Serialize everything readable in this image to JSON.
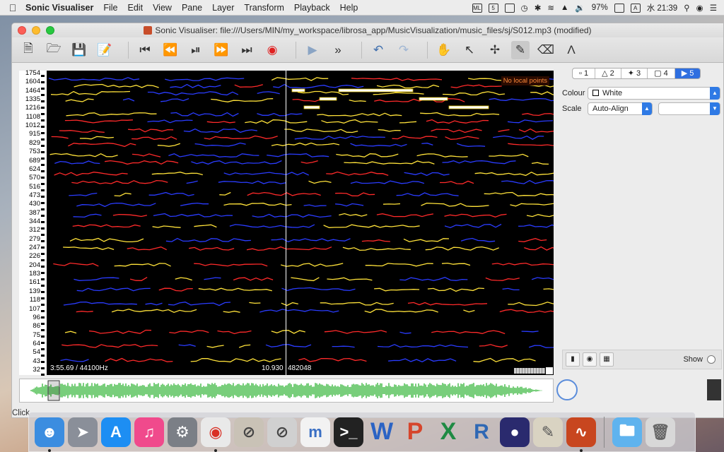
{
  "menubar": {
    "app_name": "Sonic Visualiser",
    "items": [
      "File",
      "Edit",
      "View",
      "Pane",
      "Layer",
      "Transform",
      "Playback",
      "Help"
    ],
    "battery": "97%",
    "input_source": "A",
    "clock": "水 21:39"
  },
  "window": {
    "title": "Sonic Visualiser: file:///Users/MIN/my_workspace/librosa_app/MusicVisualization/music_files/sj/S012.mp3 (modified)"
  },
  "toolbar": {
    "buttons": [
      "new-document-icon",
      "open-icon",
      "save-icon",
      "save-as-icon",
      "rewind-start-icon",
      "rewind-icon",
      "play-pause-icon",
      "fast-forward-icon",
      "fast-forward-end-icon",
      "record-icon",
      "play-selection-icon",
      "solo-icon",
      "undo-icon",
      "redo-icon",
      "navigate-icon",
      "select-icon",
      "move-icon",
      "draw-icon",
      "erase-icon",
      "measure-icon"
    ]
  },
  "spectrogram": {
    "scale_labels": [
      "1754",
      "1604",
      "1464",
      "1335",
      "1216",
      "1108",
      "1012",
      "915",
      "829",
      "753",
      "689",
      "624",
      "570",
      "516",
      "473",
      "430",
      "387",
      "344",
      "312",
      "279",
      "247",
      "226",
      "204",
      "183",
      "161",
      "139",
      "118",
      "107",
      "96",
      "86",
      "75",
      "64",
      "54",
      "43",
      "32"
    ],
    "position_info": "3:55.69 / 44100Hz",
    "seconds": "10.930",
    "frame": "482048",
    "no_local_points": "No local points"
  },
  "panel": {
    "tabs": [
      "1",
      "2",
      "3",
      "4",
      "5"
    ],
    "active_tab": "5",
    "colour_label": "Colour",
    "colour_value": "White",
    "scale_label": "Scale",
    "scale_value": "Auto-Align",
    "scale_second_value": "",
    "show_label": "Show"
  },
  "status": {
    "text": "Click"
  },
  "dock": {
    "apps": [
      "finder-icon",
      "launchpad-icon",
      "app-store-icon",
      "itunes-icon",
      "system-preferences-icon",
      "chrome-icon",
      "dictionary-app-icon",
      "no-entry-app-icon",
      "musescore-icon",
      "terminal-icon",
      "word-icon",
      "powerpoint-icon",
      "excel-icon",
      "r-icon",
      "eclipse-icon",
      "preview-icon",
      "sonic-visualiser-icon",
      "downloads-folder-icon",
      "trash-icon"
    ]
  },
  "colors": {
    "accent_blue": "#2f6fe0",
    "spectrogram_bg": "#000000",
    "peak_yellow": "#ffe23a",
    "peak_red": "#ff2a2a",
    "peak_blue": "#2a3cff",
    "waveform_green": "#57c25a"
  }
}
